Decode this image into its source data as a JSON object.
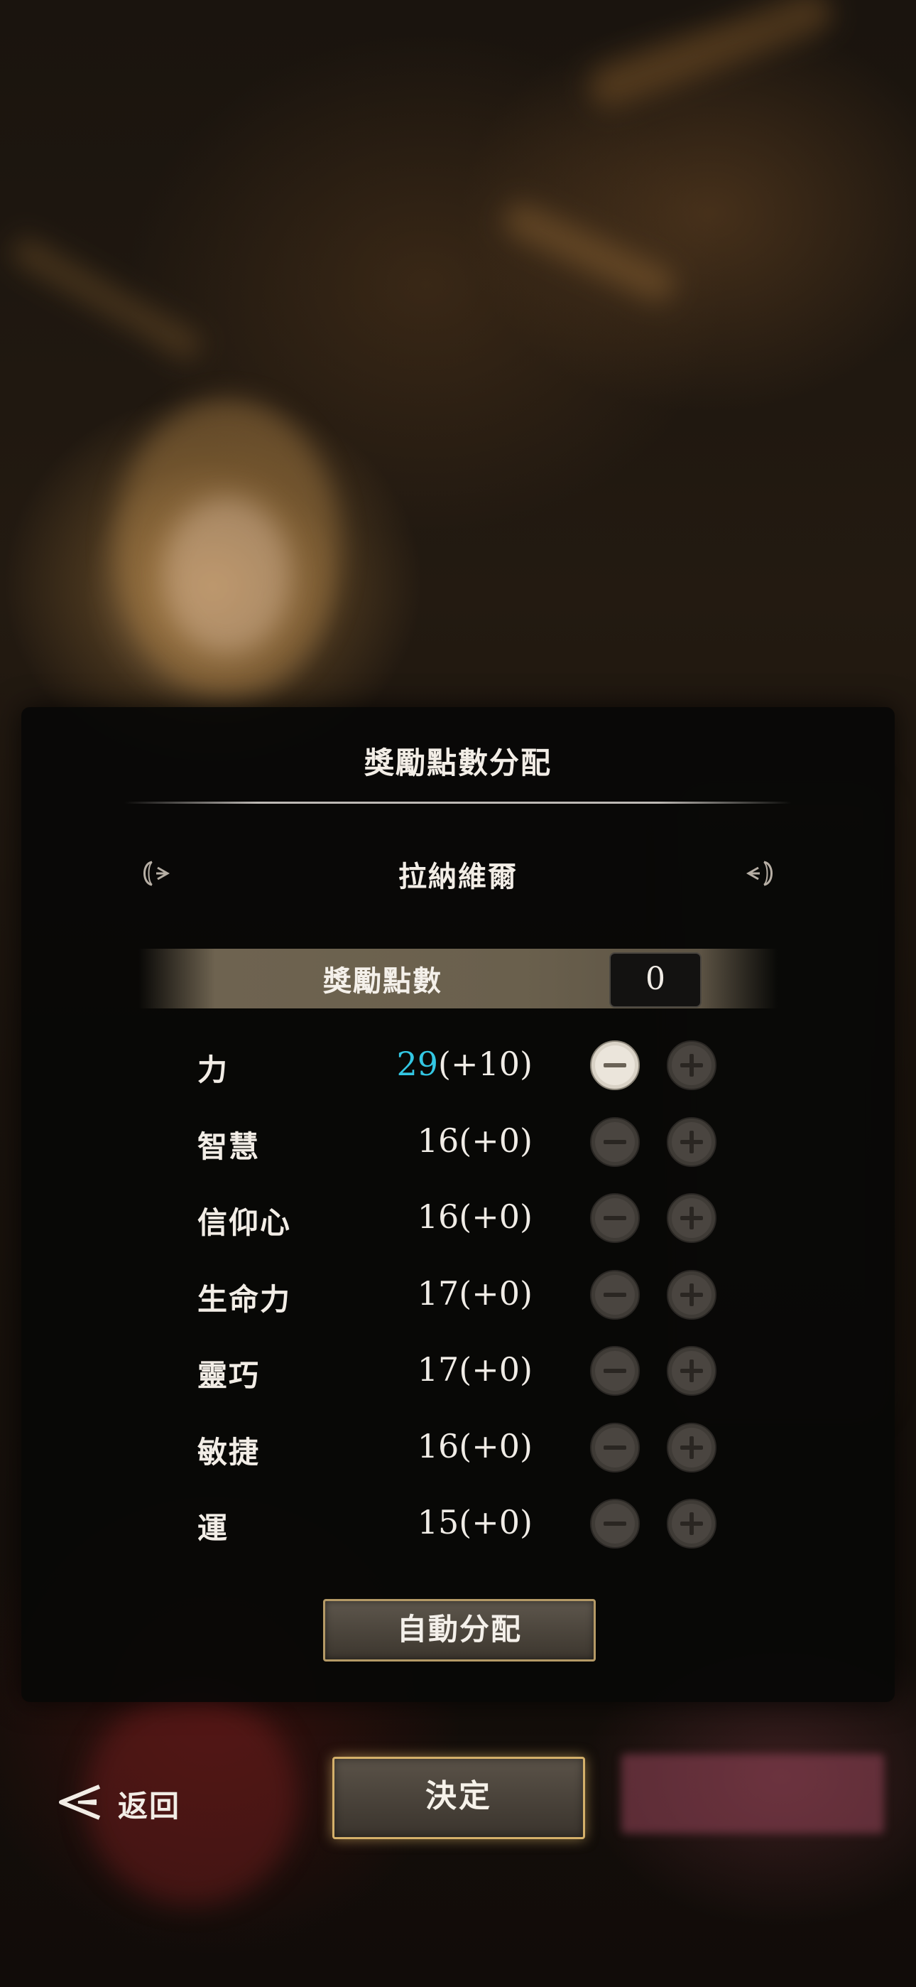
{
  "panel": {
    "title": "獎勵點數分配",
    "character_name": "拉納維爾"
  },
  "reward_points": {
    "label": "獎勵點數",
    "value": "0"
  },
  "stats": [
    {
      "name": "力",
      "base": "29",
      "bonus": "(+10)",
      "boosted": true
    },
    {
      "name": "智慧",
      "base": "16",
      "bonus": "(+0)",
      "boosted": false
    },
    {
      "name": "信仰心",
      "base": "16",
      "bonus": "(+0)",
      "boosted": false
    },
    {
      "name": "生命力",
      "base": "17",
      "bonus": "(+0)",
      "boosted": false
    },
    {
      "name": "靈巧",
      "base": "17",
      "bonus": "(+0)",
      "boosted": false
    },
    {
      "name": "敏捷",
      "base": "16",
      "bonus": "(+0)",
      "boosted": false
    },
    {
      "name": "運",
      "base": "15",
      "bonus": "(+0)",
      "boosted": false
    }
  ],
  "buttons": {
    "auto_allocate": "自動分配",
    "back": "返回",
    "confirm": "決定"
  },
  "colors": {
    "boosted_value": "#33c7e3",
    "button_border_gold": "#d4b06a"
  },
  "icons": {
    "prev": "ornate-left-arrow-icon",
    "next": "ornate-right-arrow-icon",
    "minus": "minus-circle-icon",
    "plus": "plus-circle-icon",
    "back": "back-arrow-icon"
  }
}
